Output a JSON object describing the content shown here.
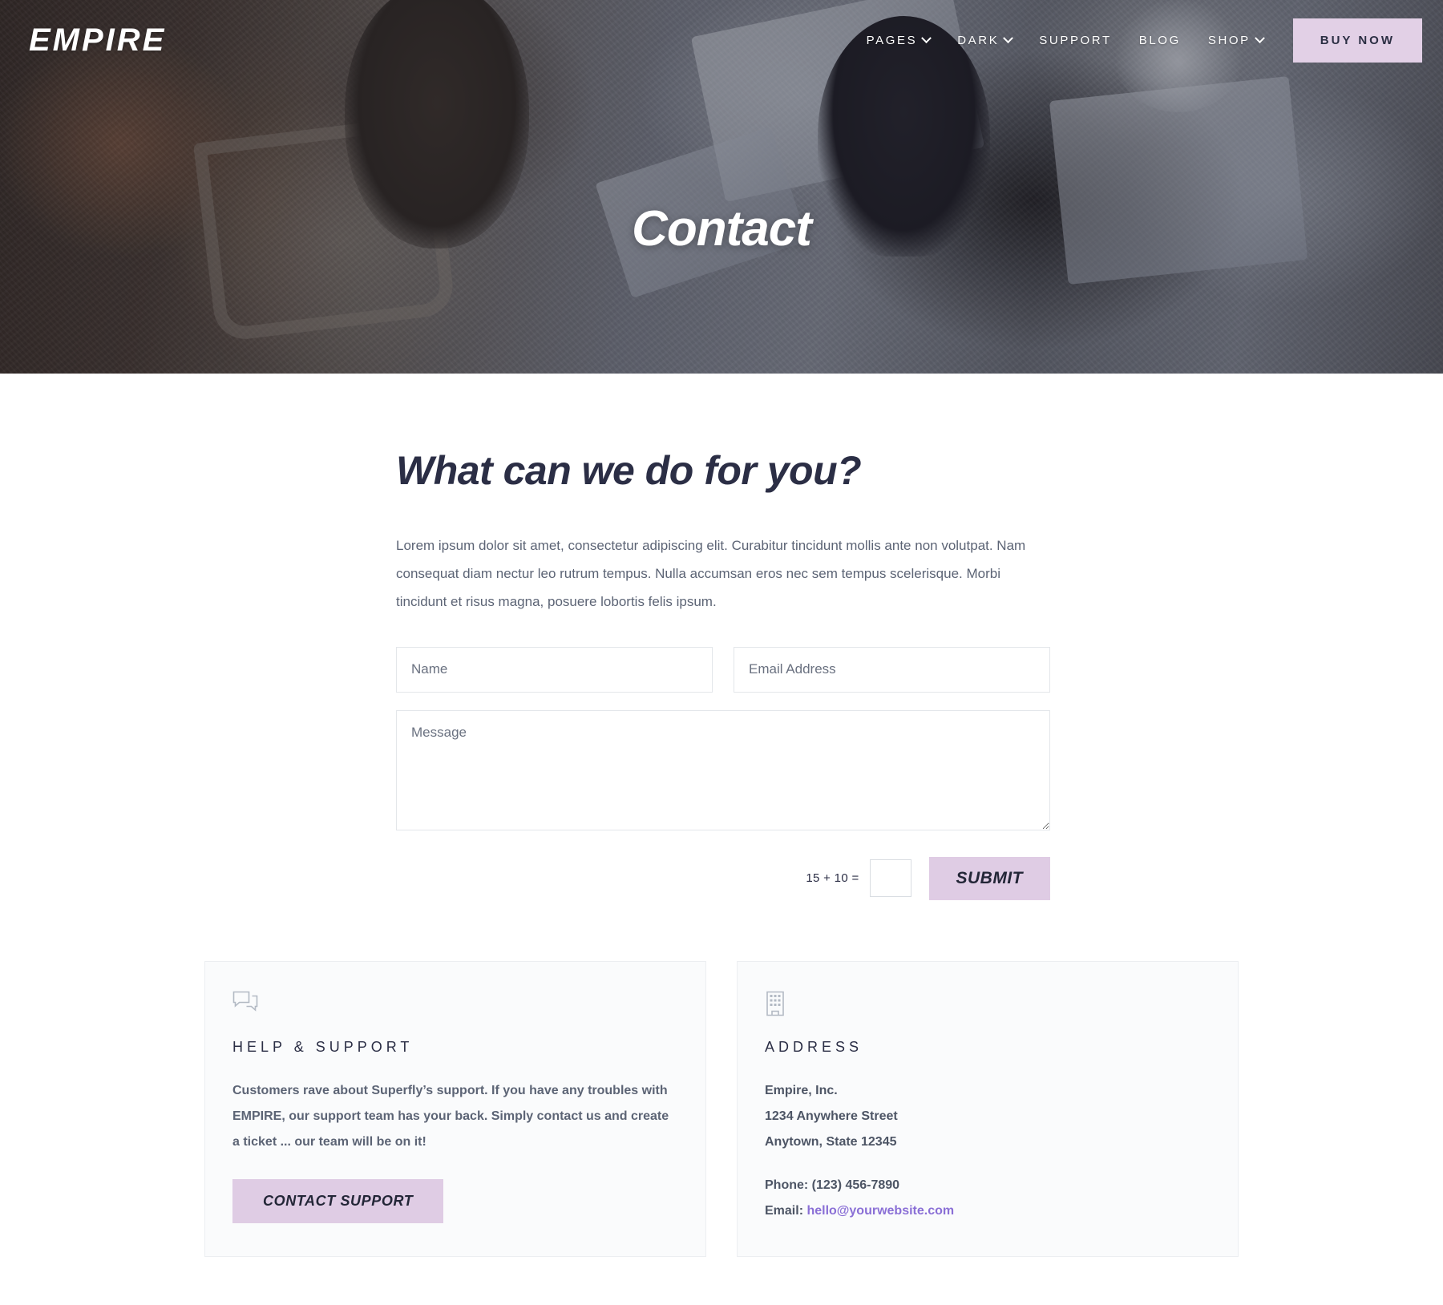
{
  "site": {
    "logo": "EMPIRE"
  },
  "nav": {
    "items": [
      {
        "label": "PAGES",
        "has_caret": true
      },
      {
        "label": "DARK",
        "has_caret": true
      },
      {
        "label": "SUPPORT",
        "has_caret": false
      },
      {
        "label": "BLOG",
        "has_caret": false
      },
      {
        "label": "SHOP",
        "has_caret": true
      }
    ],
    "cta_label": "BUY NOW"
  },
  "hero": {
    "title": "Contact"
  },
  "contact": {
    "heading": "What can we do for you?",
    "paragraph": "Lorem ipsum dolor sit amet, consectetur adipiscing elit. Curabitur tincidunt mollis ante non volutpat. Nam consequat diam nectur leo rutrum tempus. Nulla accumsan eros nec sem tempus scelerisque. Morbi tincidunt et risus magna, posuere lobortis felis ipsum.",
    "form": {
      "name_placeholder": "Name",
      "name_value": "",
      "email_placeholder": "Email Address",
      "email_value": "",
      "message_placeholder": "Message",
      "message_value": "",
      "captcha_question": "15 + 10 =",
      "captcha_value": "",
      "submit_label": "SUBMIT"
    }
  },
  "cards": {
    "support": {
      "icon": "chat-bubbles-icon",
      "title": "HELP & SUPPORT",
      "body": "Customers rave about Superfly’s support. If you have any troubles with EMPIRE, our support team has your back. Simply contact us and create a ticket ... our team will be on it!",
      "button_label": "CONTACT SUPPORT"
    },
    "address": {
      "icon": "building-icon",
      "title": "ADDRESS",
      "company": "Empire, Inc.",
      "street": "1234 Anywhere Street",
      "city": "Anytown, State 12345",
      "phone": "Phone: (123) 456-7890",
      "email_label": "Email: ",
      "email": "hello@yourwebsite.com"
    }
  },
  "colors": {
    "accent_lavender": "#dfcce4",
    "heading_navy": "#2b2e45",
    "body_gray": "#5c6475",
    "link_purple": "#8a6fd6",
    "card_bg": "#fafbfc"
  }
}
